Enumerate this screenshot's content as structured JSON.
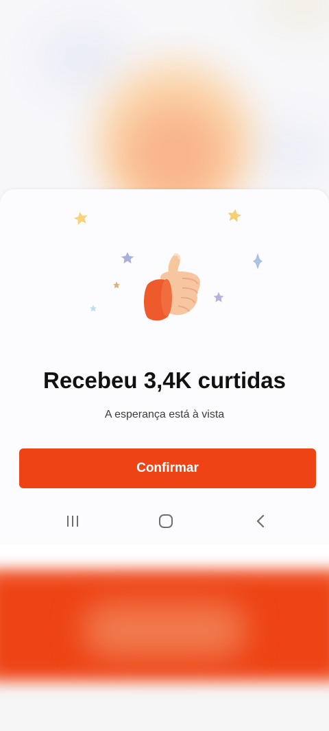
{
  "dialog": {
    "title": "Recebeu 3,4K curtidas",
    "subtitle": "A esperança está à vista",
    "confirm_label": "Confirmar"
  },
  "colors": {
    "accent": "#ee4314",
    "title": "#111111",
    "subtitle": "#3b3b3b"
  },
  "illustration": {
    "icon": "thumbs-up-icon",
    "decorations": [
      "star-icon"
    ]
  },
  "system_nav": {
    "recent_icon": "recent-apps-icon",
    "home_icon": "home-icon",
    "back_icon": "back-icon"
  }
}
